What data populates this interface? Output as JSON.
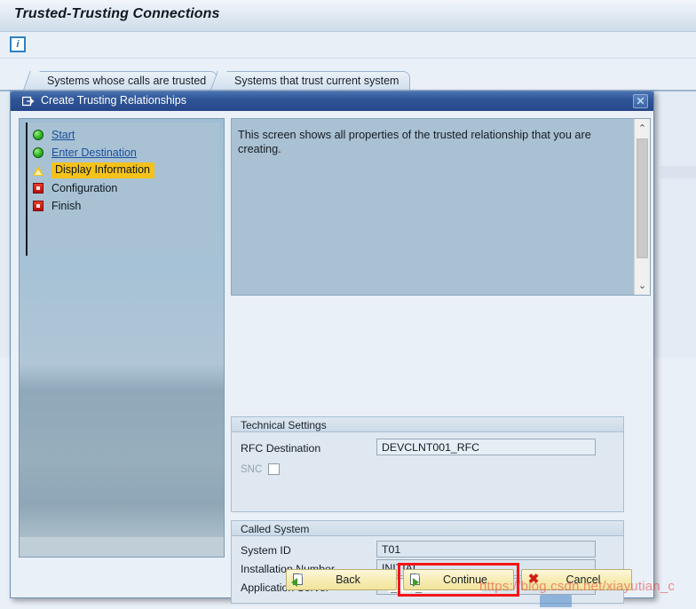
{
  "app": {
    "title": "Trusted-Trusting Connections",
    "toolbar": {
      "info_icon": "info-icon",
      "info_glyph": "i"
    }
  },
  "tabs": [
    {
      "label": "Systems whose calls are trusted",
      "selected": true
    },
    {
      "label": "Systems that trust current system",
      "selected": false
    }
  ],
  "dialog": {
    "title": "Create  Trusting Relationships",
    "close_label": "✕",
    "wizard": {
      "steps": [
        {
          "label": "Start",
          "status": "complete",
          "icon": "green-circle-icon",
          "style": "link"
        },
        {
          "label": "Enter Destination",
          "status": "complete",
          "icon": "green-circle-icon",
          "style": "link"
        },
        {
          "label": "Display Information",
          "status": "current",
          "icon": "warning-triangle-icon",
          "style": "current"
        },
        {
          "label": "Configuration",
          "status": "pending",
          "icon": "red-square-icon",
          "style": "plain"
        },
        {
          "label": "Finish",
          "status": "pending",
          "icon": "red-square-icon",
          "style": "plain"
        }
      ]
    },
    "description": "This screen shows all properties of the trusted relationship that you are creating.",
    "scrollbar": {
      "up_arrow": "⌃",
      "down_arrow": "⌄"
    },
    "groups": [
      {
        "title": "Technical Settings",
        "fields": [
          {
            "label": "RFC Destination",
            "value": "DEVCLNT001_RFC",
            "type": "text",
            "focused": true,
            "disabled": false
          },
          {
            "label": "SNC",
            "value": "",
            "type": "checkbox",
            "checked": false,
            "disabled": true
          }
        ]
      },
      {
        "title": "Called System",
        "fields": [
          {
            "label": "System ID",
            "value": "T01",
            "type": "text",
            "focused": false,
            "disabled": false
          },
          {
            "label": "Installation Number",
            "value": "INITIAL",
            "type": "text",
            "focused": false,
            "disabled": false
          },
          {
            "label": "Application Server",
            "value": "n                      _T01_00",
            "type": "text",
            "focused": false,
            "disabled": false,
            "redacted": true
          }
        ]
      }
    ],
    "buttons": [
      {
        "label": "Back",
        "icon": "document-back-arrow-icon",
        "highlighted": false
      },
      {
        "label": "Continue",
        "icon": "document-forward-arrow-icon",
        "highlighted": true
      },
      {
        "label": "Cancel",
        "icon": "red-x-icon",
        "highlighted": false
      }
    ]
  },
  "watermark": {
    "text": "https://blog.csdn.net/xiayutian_c"
  },
  "colors": {
    "accent_blue": "#2f5596",
    "current_step": "#f5c21b",
    "highlight_red": "#f41616",
    "button_yellow": "#f7edb4",
    "link_blue": "#1b4f9c"
  }
}
